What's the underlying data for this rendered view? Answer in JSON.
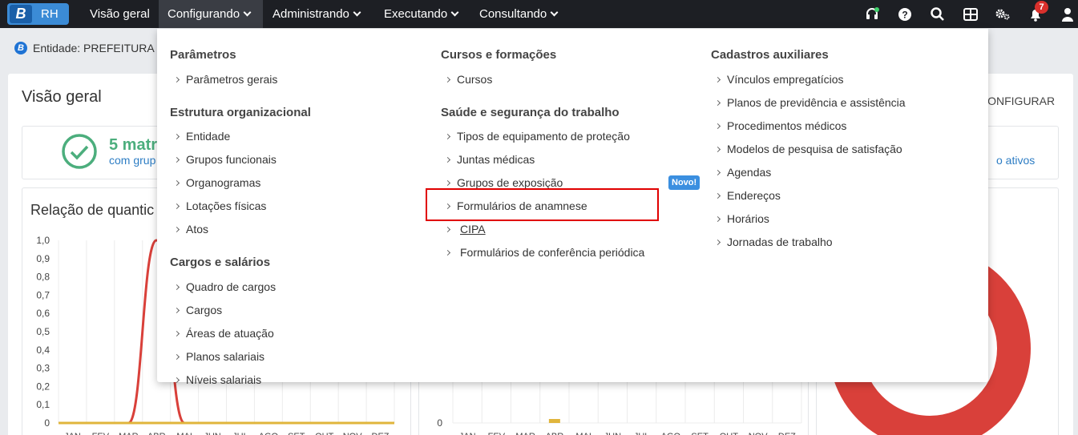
{
  "topbar": {
    "logo_letter": "B",
    "logo_text": "RH",
    "nav": [
      {
        "label": "Visão geral"
      },
      {
        "label": "Configurando"
      },
      {
        "label": "Administrando"
      },
      {
        "label": "Executando"
      },
      {
        "label": "Consultando"
      }
    ],
    "notification_count": "7"
  },
  "entity": {
    "badge": "B",
    "text": "Entidade: PREFEITURA D"
  },
  "page": {
    "title": "Visão geral",
    "configurar": "CONFIGURAR",
    "summary_big": "5 matr",
    "summary_sub": "com grup",
    "summary_right": "o ativos",
    "chart_title": "Relação de quantic"
  },
  "chart_data": [
    {
      "type": "line",
      "title": "Relação de quantic",
      "categories": [
        "JAN",
        "FEV",
        "MAR",
        "ABR",
        "MAI",
        "JUN",
        "JUL",
        "AGO",
        "SET",
        "OUT",
        "NOV",
        "DEZ"
      ],
      "ylim": [
        0,
        1.0
      ],
      "yticks": [
        "0",
        "0,1",
        "0,2",
        "0,3",
        "0,4",
        "0,5",
        "0,6",
        "0,7",
        "0,8",
        "0,9",
        "1,0"
      ],
      "series": [
        {
          "values": [
            0,
            0,
            0,
            1,
            0,
            0,
            0,
            0,
            0,
            0,
            0,
            0
          ],
          "color": "#d9403a"
        },
        {
          "values": [
            0,
            0,
            0,
            0,
            0,
            0,
            0,
            0,
            0,
            0,
            0,
            0
          ],
          "color": "#e0b53c"
        }
      ]
    },
    {
      "type": "bar",
      "categories": [
        "JAN",
        "FEV",
        "MAR",
        "ABR",
        "MAI",
        "JUN",
        "JUL",
        "AGO",
        "SET",
        "OUT",
        "NOV",
        "DEZ"
      ],
      "yticks": [
        "0"
      ],
      "values": [
        0,
        0,
        0,
        0.05,
        0,
        0,
        0,
        0,
        0,
        0,
        0,
        0
      ],
      "color": "#e0b53c"
    },
    {
      "type": "pie",
      "color": "#d9403a"
    }
  ],
  "menu": {
    "columns": [
      {
        "sections": [
          {
            "title": "Parâmetros",
            "items": [
              {
                "label": "Parâmetros gerais"
              }
            ]
          },
          {
            "title": "Estrutura organizacional",
            "items": [
              {
                "label": "Entidade"
              },
              {
                "label": "Grupos funcionais"
              },
              {
                "label": "Organogramas"
              },
              {
                "label": "Lotações físicas"
              },
              {
                "label": "Atos"
              }
            ]
          },
          {
            "title": "Cargos e salários",
            "items": [
              {
                "label": "Quadro de cargos"
              },
              {
                "label": "Cargos"
              },
              {
                "label": "Áreas de atuação"
              },
              {
                "label": "Planos salariais"
              },
              {
                "label": "Níveis salariais"
              }
            ]
          }
        ]
      },
      {
        "sections": [
          {
            "title": "Cursos e formações",
            "items": [
              {
                "label": "Cursos"
              }
            ]
          },
          {
            "title": "Saúde e segurança do trabalho",
            "items": [
              {
                "label": "Tipos de equipamento de proteção"
              },
              {
                "label": "Juntas médicas"
              },
              {
                "label": "Grupos de exposição"
              },
              {
                "label": "Formulários de anamnese"
              },
              {
                "label": "CIPA"
              },
              {
                "label": "Formulários de conferência periódica"
              }
            ]
          }
        ]
      },
      {
        "sections": [
          {
            "title": "Cadastros auxiliares",
            "items": [
              {
                "label": "Vínculos empregatícios"
              },
              {
                "label": "Planos de previdência e assistência"
              },
              {
                "label": "Procedimentos médicos"
              },
              {
                "label": "Modelos de pesquisa de satisfação"
              },
              {
                "label": "Agendas"
              },
              {
                "label": "Endereços"
              },
              {
                "label": "Horários"
              },
              {
                "label": "Jornadas de trabalho"
              }
            ]
          }
        ]
      }
    ],
    "new_badge": "Novo!"
  }
}
